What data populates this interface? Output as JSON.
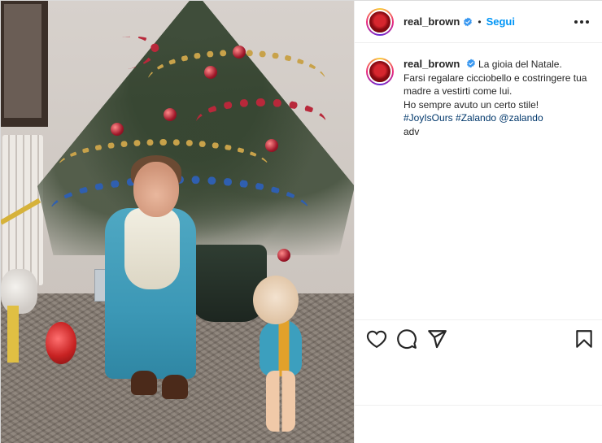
{
  "header": {
    "username": "real_brown",
    "separator": "•",
    "follow_label": "Segui"
  },
  "caption": {
    "username": "real_brown",
    "lines": [
      "La gioia del Natale.",
      "Farsi regalare cicciobello e costringere tua madre a vestirti come lui.",
      "Ho sempre avuto un certo stile!"
    ],
    "hashtags": "#JoyIsOurs #Zalando",
    "mention": "@zalando",
    "tag": "adv"
  },
  "icons": {
    "verified": "verified-badge-icon",
    "more": "more-options-icon",
    "like": "heart-icon",
    "comment": "comment-icon",
    "share": "paper-plane-icon",
    "save": "bookmark-icon"
  },
  "colors": {
    "link_blue": "#0095f6",
    "hashtag": "#00376b",
    "verified": "#3897f0"
  }
}
